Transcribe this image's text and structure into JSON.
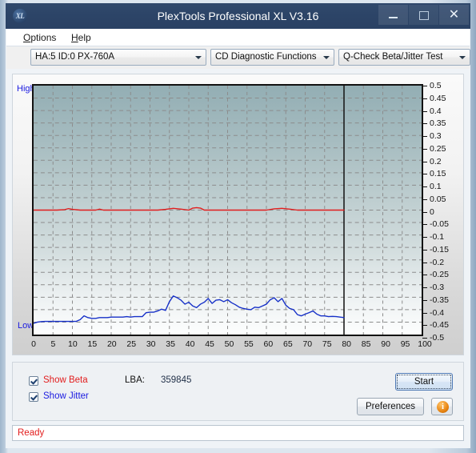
{
  "window": {
    "title": "PlexTools Professional XL V3.16",
    "icon_name": "xl-logo-icon",
    "icon_text": "XL",
    "buttons": {
      "minimize": "minimize-button",
      "maximize": "maximize-button",
      "close": "close-button"
    }
  },
  "menubar": {
    "items": [
      {
        "label": "Options",
        "accel": "O"
      },
      {
        "label": "Help",
        "accel": "H"
      }
    ]
  },
  "toolbar": {
    "drive_select": "HA:5 ID:0  PX-760A",
    "function_select": "CD Diagnostic Functions",
    "test_select": "Q-Check Beta/Jitter Test"
  },
  "chart_panel": {
    "high_label": "High",
    "low_label": "Low"
  },
  "options": {
    "show_beta_label": "Show Beta",
    "show_beta_checked": true,
    "show_beta_color": "#e21d1d",
    "show_jitter_label": "Show Jitter",
    "show_jitter_checked": true,
    "show_jitter_color": "#1a1ae0",
    "lba_label": "LBA:",
    "lba_value": "359845",
    "start_button": "Start",
    "preferences_button": "Preferences",
    "info_button_glyph": "i"
  },
  "statusbar": {
    "text": "Ready"
  },
  "chart_data": {
    "type": "line",
    "title": "Q-Check Beta/Jitter Test",
    "xlabel": "",
    "ylabel": "",
    "xlim": [
      0,
      100
    ],
    "ylim": [
      -0.5,
      0.5
    ],
    "grid": true,
    "legend": "none",
    "x_ticks": [
      0,
      5,
      10,
      15,
      20,
      25,
      30,
      35,
      40,
      45,
      50,
      55,
      60,
      65,
      70,
      75,
      80,
      85,
      90,
      95,
      100
    ],
    "y_ticks": [
      0.5,
      0.45,
      0.4,
      0.35,
      0.3,
      0.25,
      0.2,
      0.15,
      0.1,
      0.05,
      0,
      -0.05,
      -0.1,
      -0.15,
      -0.2,
      -0.25,
      -0.3,
      -0.35,
      -0.4,
      -0.45,
      -0.5
    ],
    "markers": [
      {
        "name": "disc-end-marker",
        "x": 80,
        "color": "#1b1b1b"
      }
    ],
    "series": [
      {
        "name": "Beta",
        "color": "#e21d1d",
        "x": [
          0,
          2,
          4,
          6,
          8,
          9,
          10,
          12,
          14,
          16,
          17,
          18,
          20,
          22,
          24,
          26,
          28,
          30,
          32,
          34,
          36,
          38,
          40,
          41,
          42,
          43,
          44,
          46,
          48,
          50,
          52,
          54,
          56,
          58,
          60,
          62,
          64,
          66,
          68,
          70,
          72,
          74,
          76,
          78,
          79,
          80
        ],
        "values": [
          0.0,
          0.0,
          0.0,
          0.0,
          0.002,
          0.006,
          0.003,
          0.0,
          0.0,
          0.0,
          0.004,
          0.0,
          0.0,
          0.0,
          0.0,
          0.0,
          0.0,
          0.0,
          0.0,
          0.003,
          0.007,
          0.004,
          0.0,
          0.008,
          0.01,
          0.008,
          0.0,
          0.0,
          0.0,
          0.0,
          0.0,
          0.0,
          0.0,
          0.0,
          0.0,
          0.005,
          0.007,
          0.004,
          0.0,
          0.0,
          0.0,
          0.0,
          0.0,
          0.0,
          0.0,
          0.0
        ]
      },
      {
        "name": "Jitter",
        "color": "#1630c8",
        "x": [
          0,
          1,
          2,
          3,
          4,
          5,
          6,
          7,
          8,
          9,
          10,
          11,
          12,
          13,
          14,
          15,
          16,
          17,
          18,
          19,
          20,
          21,
          22,
          23,
          24,
          25,
          26,
          27,
          28,
          29,
          30,
          31,
          32,
          33,
          34,
          35,
          36,
          37,
          38,
          39,
          40,
          41,
          42,
          43,
          44,
          45,
          46,
          47,
          48,
          49,
          50,
          51,
          52,
          53,
          54,
          55,
          56,
          57,
          58,
          59,
          60,
          61,
          62,
          63,
          64,
          65,
          66,
          67,
          68,
          69,
          70,
          71,
          72,
          73,
          74,
          75,
          76,
          77,
          78,
          79,
          80
        ],
        "values": [
          -0.455,
          -0.45,
          -0.448,
          -0.447,
          -0.447,
          -0.447,
          -0.447,
          -0.447,
          -0.447,
          -0.447,
          -0.447,
          -0.447,
          -0.44,
          -0.425,
          -0.432,
          -0.435,
          -0.435,
          -0.432,
          -0.432,
          -0.432,
          -0.43,
          -0.43,
          -0.43,
          -0.43,
          -0.428,
          -0.43,
          -0.428,
          -0.428,
          -0.428,
          -0.412,
          -0.41,
          -0.41,
          -0.405,
          -0.398,
          -0.403,
          -0.368,
          -0.345,
          -0.352,
          -0.362,
          -0.378,
          -0.37,
          -0.385,
          -0.392,
          -0.378,
          -0.37,
          -0.355,
          -0.375,
          -0.362,
          -0.36,
          -0.368,
          -0.36,
          -0.372,
          -0.38,
          -0.39,
          -0.395,
          -0.398,
          -0.4,
          -0.39,
          -0.392,
          -0.385,
          -0.378,
          -0.36,
          -0.352,
          -0.368,
          -0.355,
          -0.382,
          -0.395,
          -0.4,
          -0.42,
          -0.425,
          -0.418,
          -0.412,
          -0.405,
          -0.418,
          -0.425,
          -0.425,
          -0.428,
          -0.427,
          -0.428,
          -0.43,
          -0.432
        ]
      }
    ]
  }
}
